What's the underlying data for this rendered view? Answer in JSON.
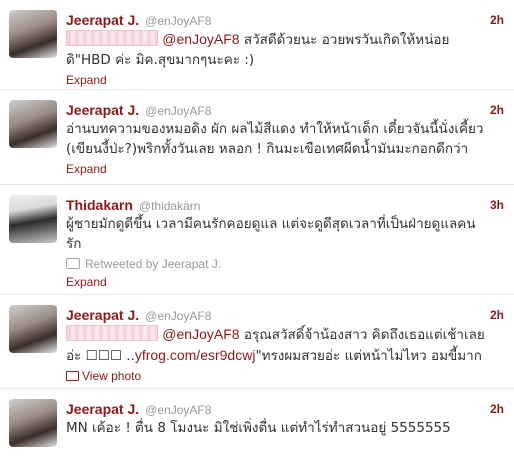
{
  "tweets": [
    {
      "name": "Jeerapat J.",
      "handle": "@enJoyAF8",
      "time": "2h",
      "mention": "@enJoyAF8",
      "text_a": " สวัสดีด้วยนะ อวยพรวันเกิดให้หน่อย",
      "text_b": "ดิ\"HBD ค่ะ มิค.สุขมากๆนะคะ :)",
      "action": "Expand"
    },
    {
      "name": "Jeerapat J.",
      "handle": "@enJoyAF8",
      "time": "2h",
      "text_a": "อ่านบทความของหมอดิง ผัก ผลไม้สีแดง ทำให้หน้าเด็ก เดี๋ยวจันนี้นั่งเคี้ยว",
      "text_b": "(เขียนงี้ป่ะ?)พริกทั้งวันเลย หลอก ! กินมะเขือเทศผีดน้ำมันมะกอกดีกว่า",
      "action": "Expand"
    },
    {
      "name": "Thidakarn",
      "handle": "@thidakarn",
      "time": "3h",
      "text_a": "ผู้ชายมักดูดีขึ้น เวลามีคนรักคอยดูแล แต่จะดูดีสุดเวลาที่เป็นฝ่ายดูแลคน",
      "text_b": "รัก",
      "retweeted": "Retweeted by Jeerapat J.",
      "action": "Expand"
    },
    {
      "name": "Jeerapat J.",
      "handle": "@enJoyAF8",
      "time": "2h",
      "mention": "@enJoyAF8",
      "text_a": " อรุณสวัสดิ์จ้าน้องสาว คิดถึงเธอแต่เช้าเลย",
      "text_b_pre": "อ่ะ ☐☐☐ ..",
      "link": "yfrog.com/esr9dcwj",
      "text_b_post": "\"ทรงผมสวยอ่ะ แต่หน้าไม่ไหว อมขี้มาก",
      "action": "View photo"
    },
    {
      "name": "Jeerapat J.",
      "handle": "@enJoyAF8",
      "time": "2h",
      "text_a": "MN เค้อะ ! ตื่น 8 โมงนะ มิใช่เพิ่งตื่น แต่ทำไร่ทำสวนอยู่ 5555555"
    }
  ]
}
